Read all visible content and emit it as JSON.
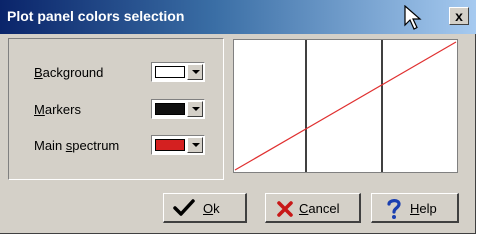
{
  "window": {
    "title": "Plot panel colors selection",
    "close_glyph": "x"
  },
  "settings": {
    "rows": [
      {
        "label_pre": "",
        "label_accel": "B",
        "label_post": "ackground",
        "color": "#ffffff"
      },
      {
        "label_pre": "",
        "label_accel": "M",
        "label_post": "arkers",
        "color": "#101010"
      },
      {
        "label_pre": "Main ",
        "label_accel": "s",
        "label_post": "pectrum",
        "color": "#d42020"
      }
    ]
  },
  "preview": {
    "background_color": "#ffffff",
    "marker_color": "#000000",
    "spectrum_color": "#e03030"
  },
  "buttons": {
    "ok": {
      "label_accel": "O",
      "label_post": "k",
      "icon": "checkmark-icon"
    },
    "cancel": {
      "label_accel": "C",
      "label_post": "ancel",
      "icon": "red-x-icon"
    },
    "help": {
      "label_accel": "H",
      "label_post": "elp",
      "icon": "question-mark-icon"
    }
  }
}
